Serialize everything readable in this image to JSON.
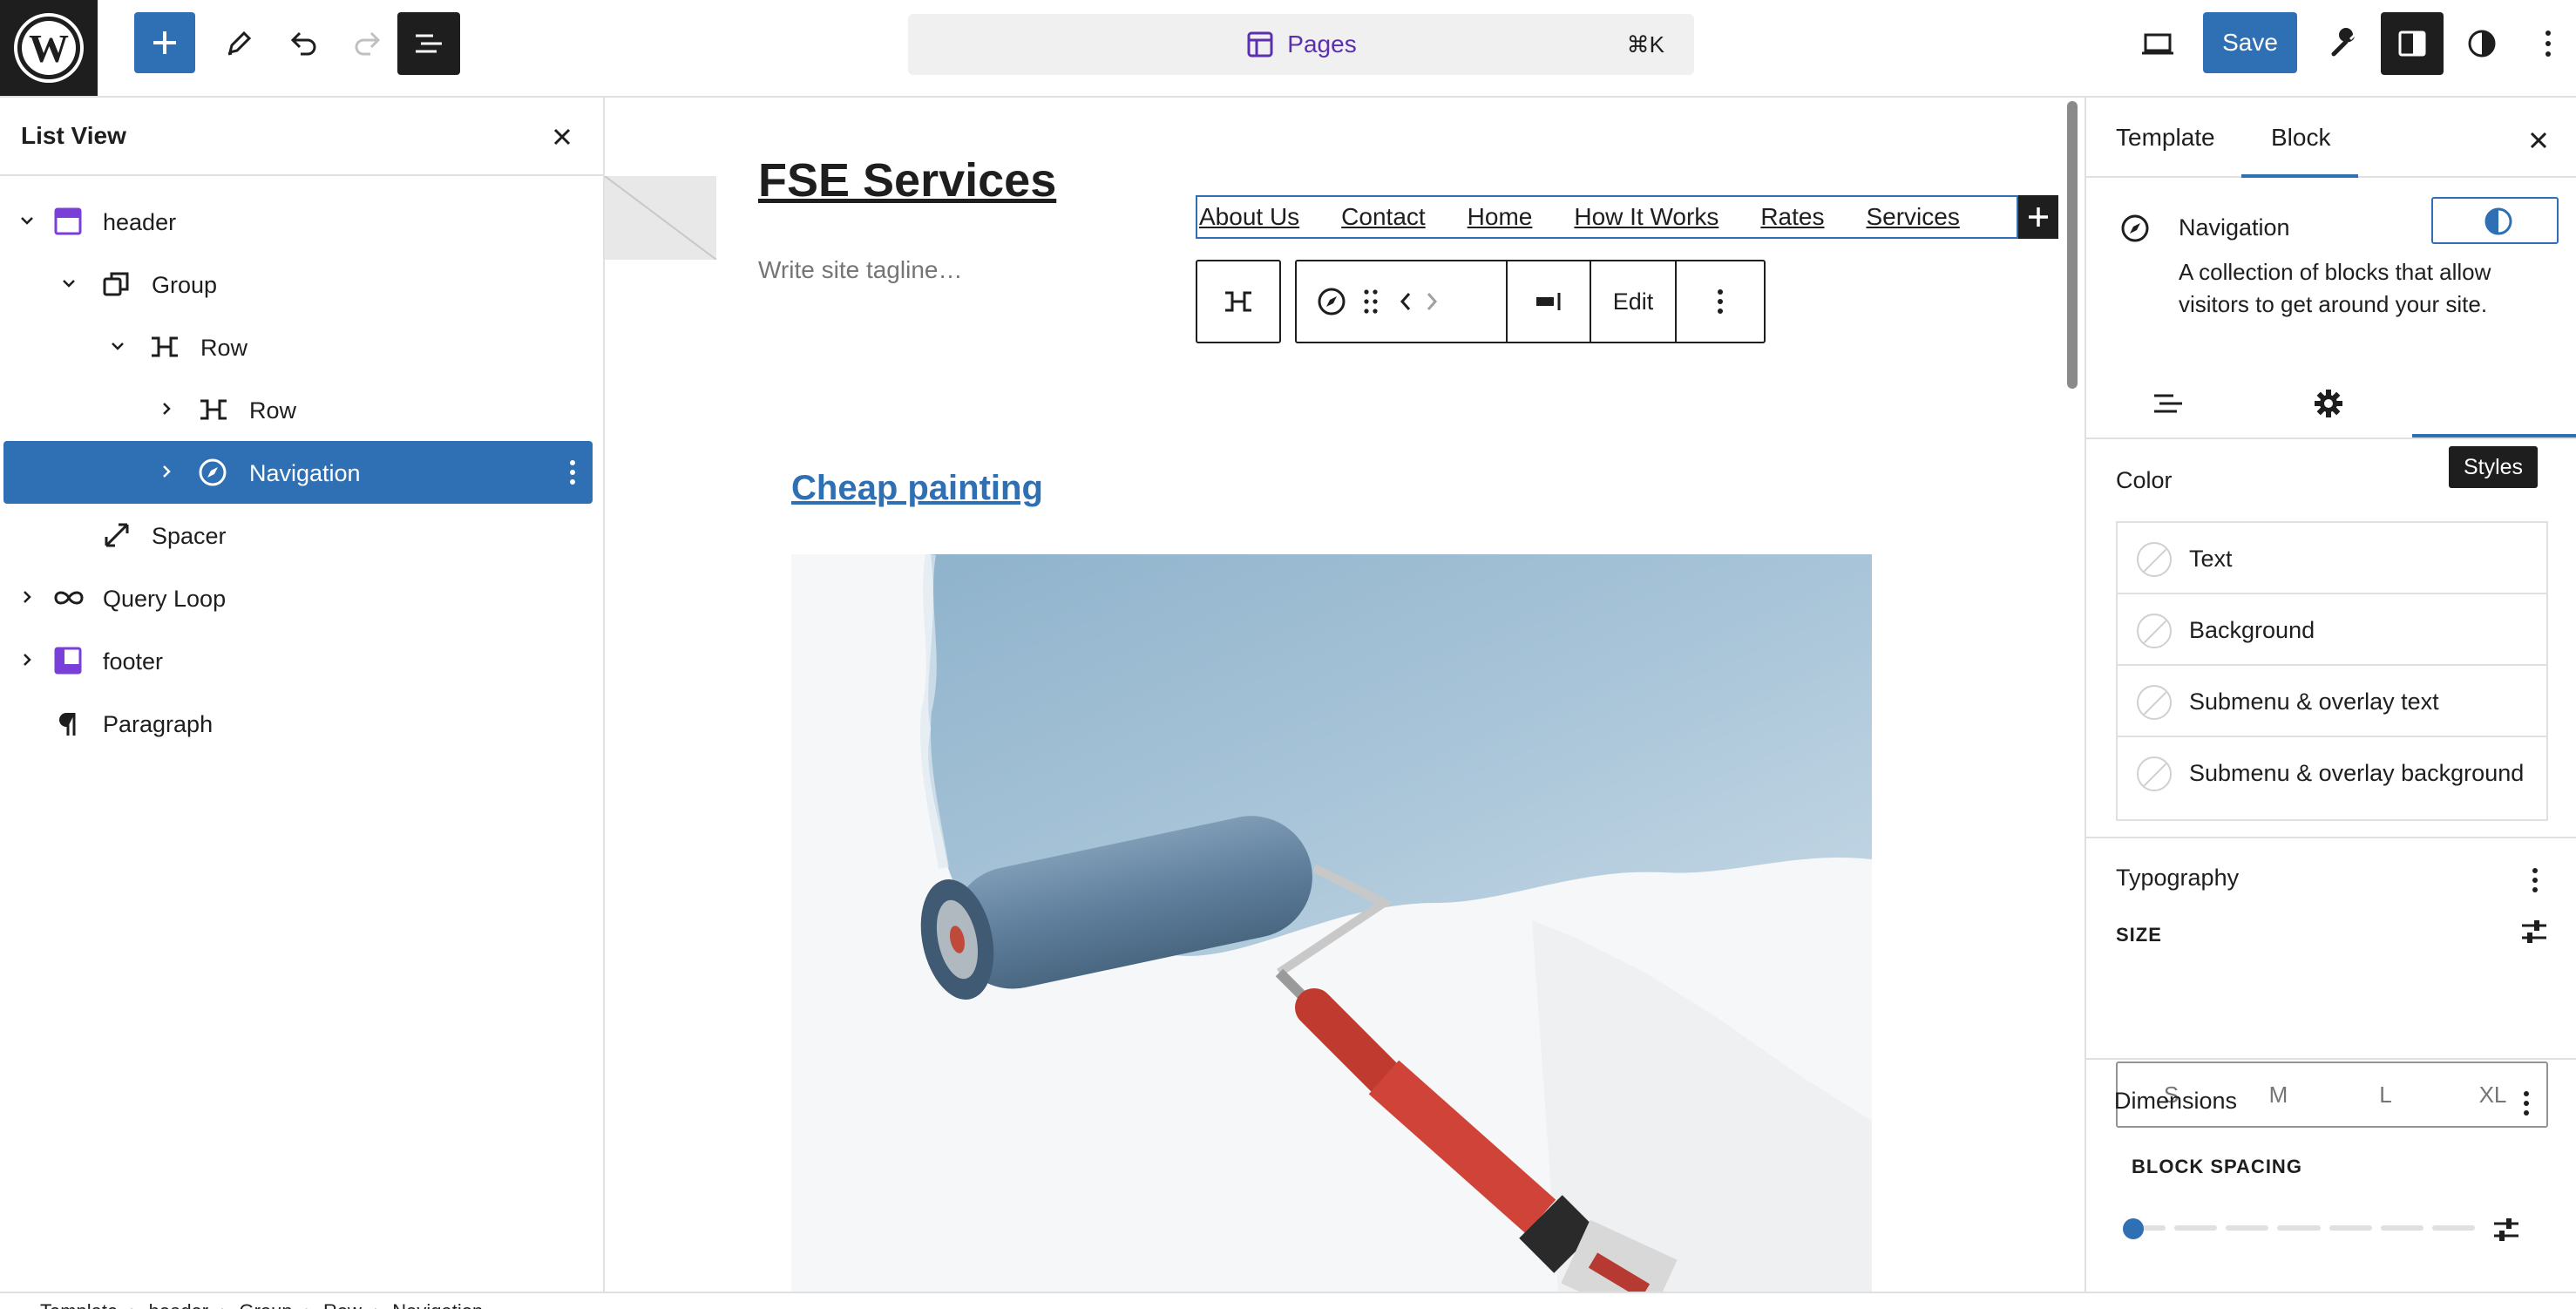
{
  "topbar": {
    "command_label": "Pages",
    "command_shortcut": "⌘K",
    "save_label": "Save"
  },
  "list_view": {
    "title": "List View",
    "items": [
      {
        "label": "header",
        "icon": "template-part-icon",
        "expanded": true
      },
      {
        "label": "Group",
        "icon": "group-icon",
        "expanded": true
      },
      {
        "label": "Row",
        "icon": "row-icon",
        "expanded": true
      },
      {
        "label": "Row",
        "icon": "row-icon",
        "expanded": false
      },
      {
        "label": "Navigation",
        "icon": "navigation-icon",
        "expanded": false,
        "selected": true
      },
      {
        "label": "Spacer",
        "icon": "spacer-icon"
      },
      {
        "label": "Query Loop",
        "icon": "loop-icon",
        "expanded": false
      },
      {
        "label": "footer",
        "icon": "template-part-icon",
        "expanded": false
      },
      {
        "label": "Paragraph",
        "icon": "paragraph-icon"
      }
    ]
  },
  "canvas": {
    "site_title": "FSE Services",
    "tagline_placeholder": "Write site tagline…",
    "nav_items": [
      "About Us",
      "Contact",
      "Home",
      "How It Works",
      "Rates",
      "Services"
    ],
    "toolbar_edit_label": "Edit",
    "post_title": "Cheap painting"
  },
  "sidebar": {
    "tabs": [
      "Template",
      "Block"
    ],
    "active_tab": "Block",
    "block_name": "Navigation",
    "block_description": "A collection of blocks that allow visitors to get around your site.",
    "tooltip": "Styles",
    "color": {
      "title": "Color",
      "items": [
        "Text",
        "Background",
        "Submenu & overlay text",
        "Submenu & overlay background"
      ]
    },
    "typography": {
      "title": "Typography",
      "size_label": "SIZE",
      "sizes": [
        "S",
        "M",
        "L",
        "XL"
      ]
    },
    "dimensions": {
      "title": "Dimensions",
      "spacing_label": "BLOCK SPACING",
      "spacing_value": 0
    }
  },
  "footer": {
    "breadcrumb": [
      "Template",
      "header",
      "Group",
      "Row",
      "Navigation"
    ]
  },
  "colors": {
    "accent": "#2f6fb3",
    "dark": "#1e1e1e",
    "template_part": "#7b3fd9"
  }
}
